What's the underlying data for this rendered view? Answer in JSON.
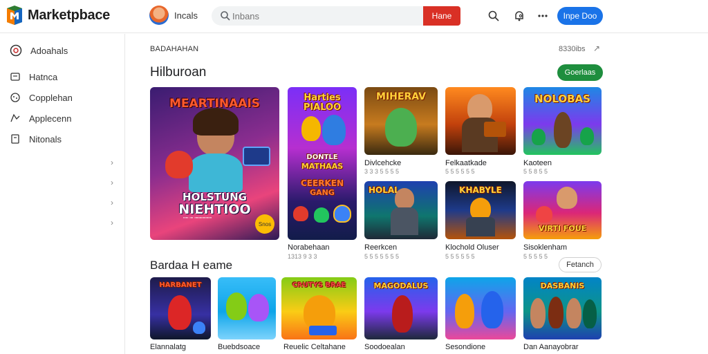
{
  "header": {
    "brand": "Marketpbace",
    "user_name": "Incals",
    "search_placeholder": "Inbans",
    "search_button": "Hane",
    "signin_button": "Inpe Doo"
  },
  "sidebar": {
    "items": [
      {
        "label": "Adoahals",
        "icon": "account-icon"
      },
      {
        "label": "Hatnca",
        "icon": "home-icon"
      },
      {
        "label": "Copplehan",
        "icon": "gamepad-icon"
      },
      {
        "label": "Applecenn",
        "icon": "apps-icon"
      },
      {
        "label": "Nitonals",
        "icon": "bookmark-icon"
      }
    ]
  },
  "main": {
    "breadcrumb": "BADAHAHAN",
    "breadcrumb_right": "8330ibs",
    "section_title": "Hilburoan",
    "section_button": "Goerlaas",
    "featured": {
      "title_top": "MEARTINAAIS",
      "title_bottom_1": "HOLSTUNG",
      "title_bottom_2": "NIEHTIOO",
      "badge": "Snos",
      "caption": "\"\"\" \"\" \"\"\"\"\"\"\"\"\"\""
    },
    "tall_card": {
      "art_1": "Harties",
      "art_2": "PIALOO",
      "art_3": "DONTLE",
      "art_4": "MATHAAS",
      "art_5": "CEERKEN",
      "art_6": "GANG",
      "title": "Norabehaan",
      "sub": "1313 9 3 3"
    },
    "games_row1": [
      {
        "art": "MIHERAV",
        "title": "Divlcehcke",
        "sub": "3 3 3 5 5 5 5"
      },
      {
        "art": "",
        "title": "Felkaatkade",
        "sub": "5 5 5 5 5 5"
      },
      {
        "art": "NOLOBAS",
        "title": "Kaoteen",
        "sub": "5 5 8 5 5"
      }
    ],
    "games_row2": [
      {
        "art": "HOLAL",
        "title": "Reerkcen",
        "sub": "5 5 5 5 5 5 5"
      },
      {
        "art": "KHABYLE",
        "title": "Klochold Oluser",
        "sub": "5 5 5 5 5 5"
      },
      {
        "art": "VIRTI FOUE",
        "title": "Sisoklenham",
        "sub": "5 5 5 5 5"
      }
    ],
    "second_title": "Bardaa H eame",
    "second_button": "Fetanch",
    "games_row3": [
      {
        "art": "HARBANET",
        "title": "Elannalatg",
        "sub": "5 5 5 5"
      },
      {
        "art": "",
        "title": "Buebdsoace",
        "sub": "5 5 5 5"
      },
      {
        "art": "CRUTYS BRAE",
        "title": "Reuelic Celtahane",
        "sub": "5 5 5 5"
      },
      {
        "art": "MAGODALUS",
        "title": "Soodoealan",
        "sub": "5 5 5 5"
      },
      {
        "art": "",
        "title": "Sesondione",
        "sub": "5 5 5 5"
      },
      {
        "art": "DASBANIS",
        "title": "Dan Aanayobrar",
        "sub": "5 5 5 5"
      }
    ]
  },
  "colors": {
    "accent_blue": "#1a73e8",
    "accent_red": "#d93025",
    "accent_green": "#1e8e3e"
  }
}
